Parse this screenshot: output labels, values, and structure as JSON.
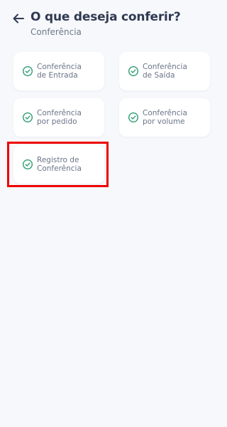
{
  "header": {
    "title": "O que deseja conferir?",
    "subtitle": "Conferência"
  },
  "options": [
    {
      "line1": "Conferência",
      "line2": "de Entrada"
    },
    {
      "line1": "Conferência",
      "line2": "de Saída"
    },
    {
      "line1": "Conferência",
      "line2": "por pedido"
    },
    {
      "line1": "Conferência",
      "line2": "por volume"
    },
    {
      "line1": "Registro de",
      "line2": "Conferência"
    }
  ],
  "colors": {
    "background": "#f7f8fc",
    "title": "#2f3a52",
    "card_text": "#6b7489",
    "check_icon": "#2f9d73",
    "highlight": "#ee0000"
  }
}
